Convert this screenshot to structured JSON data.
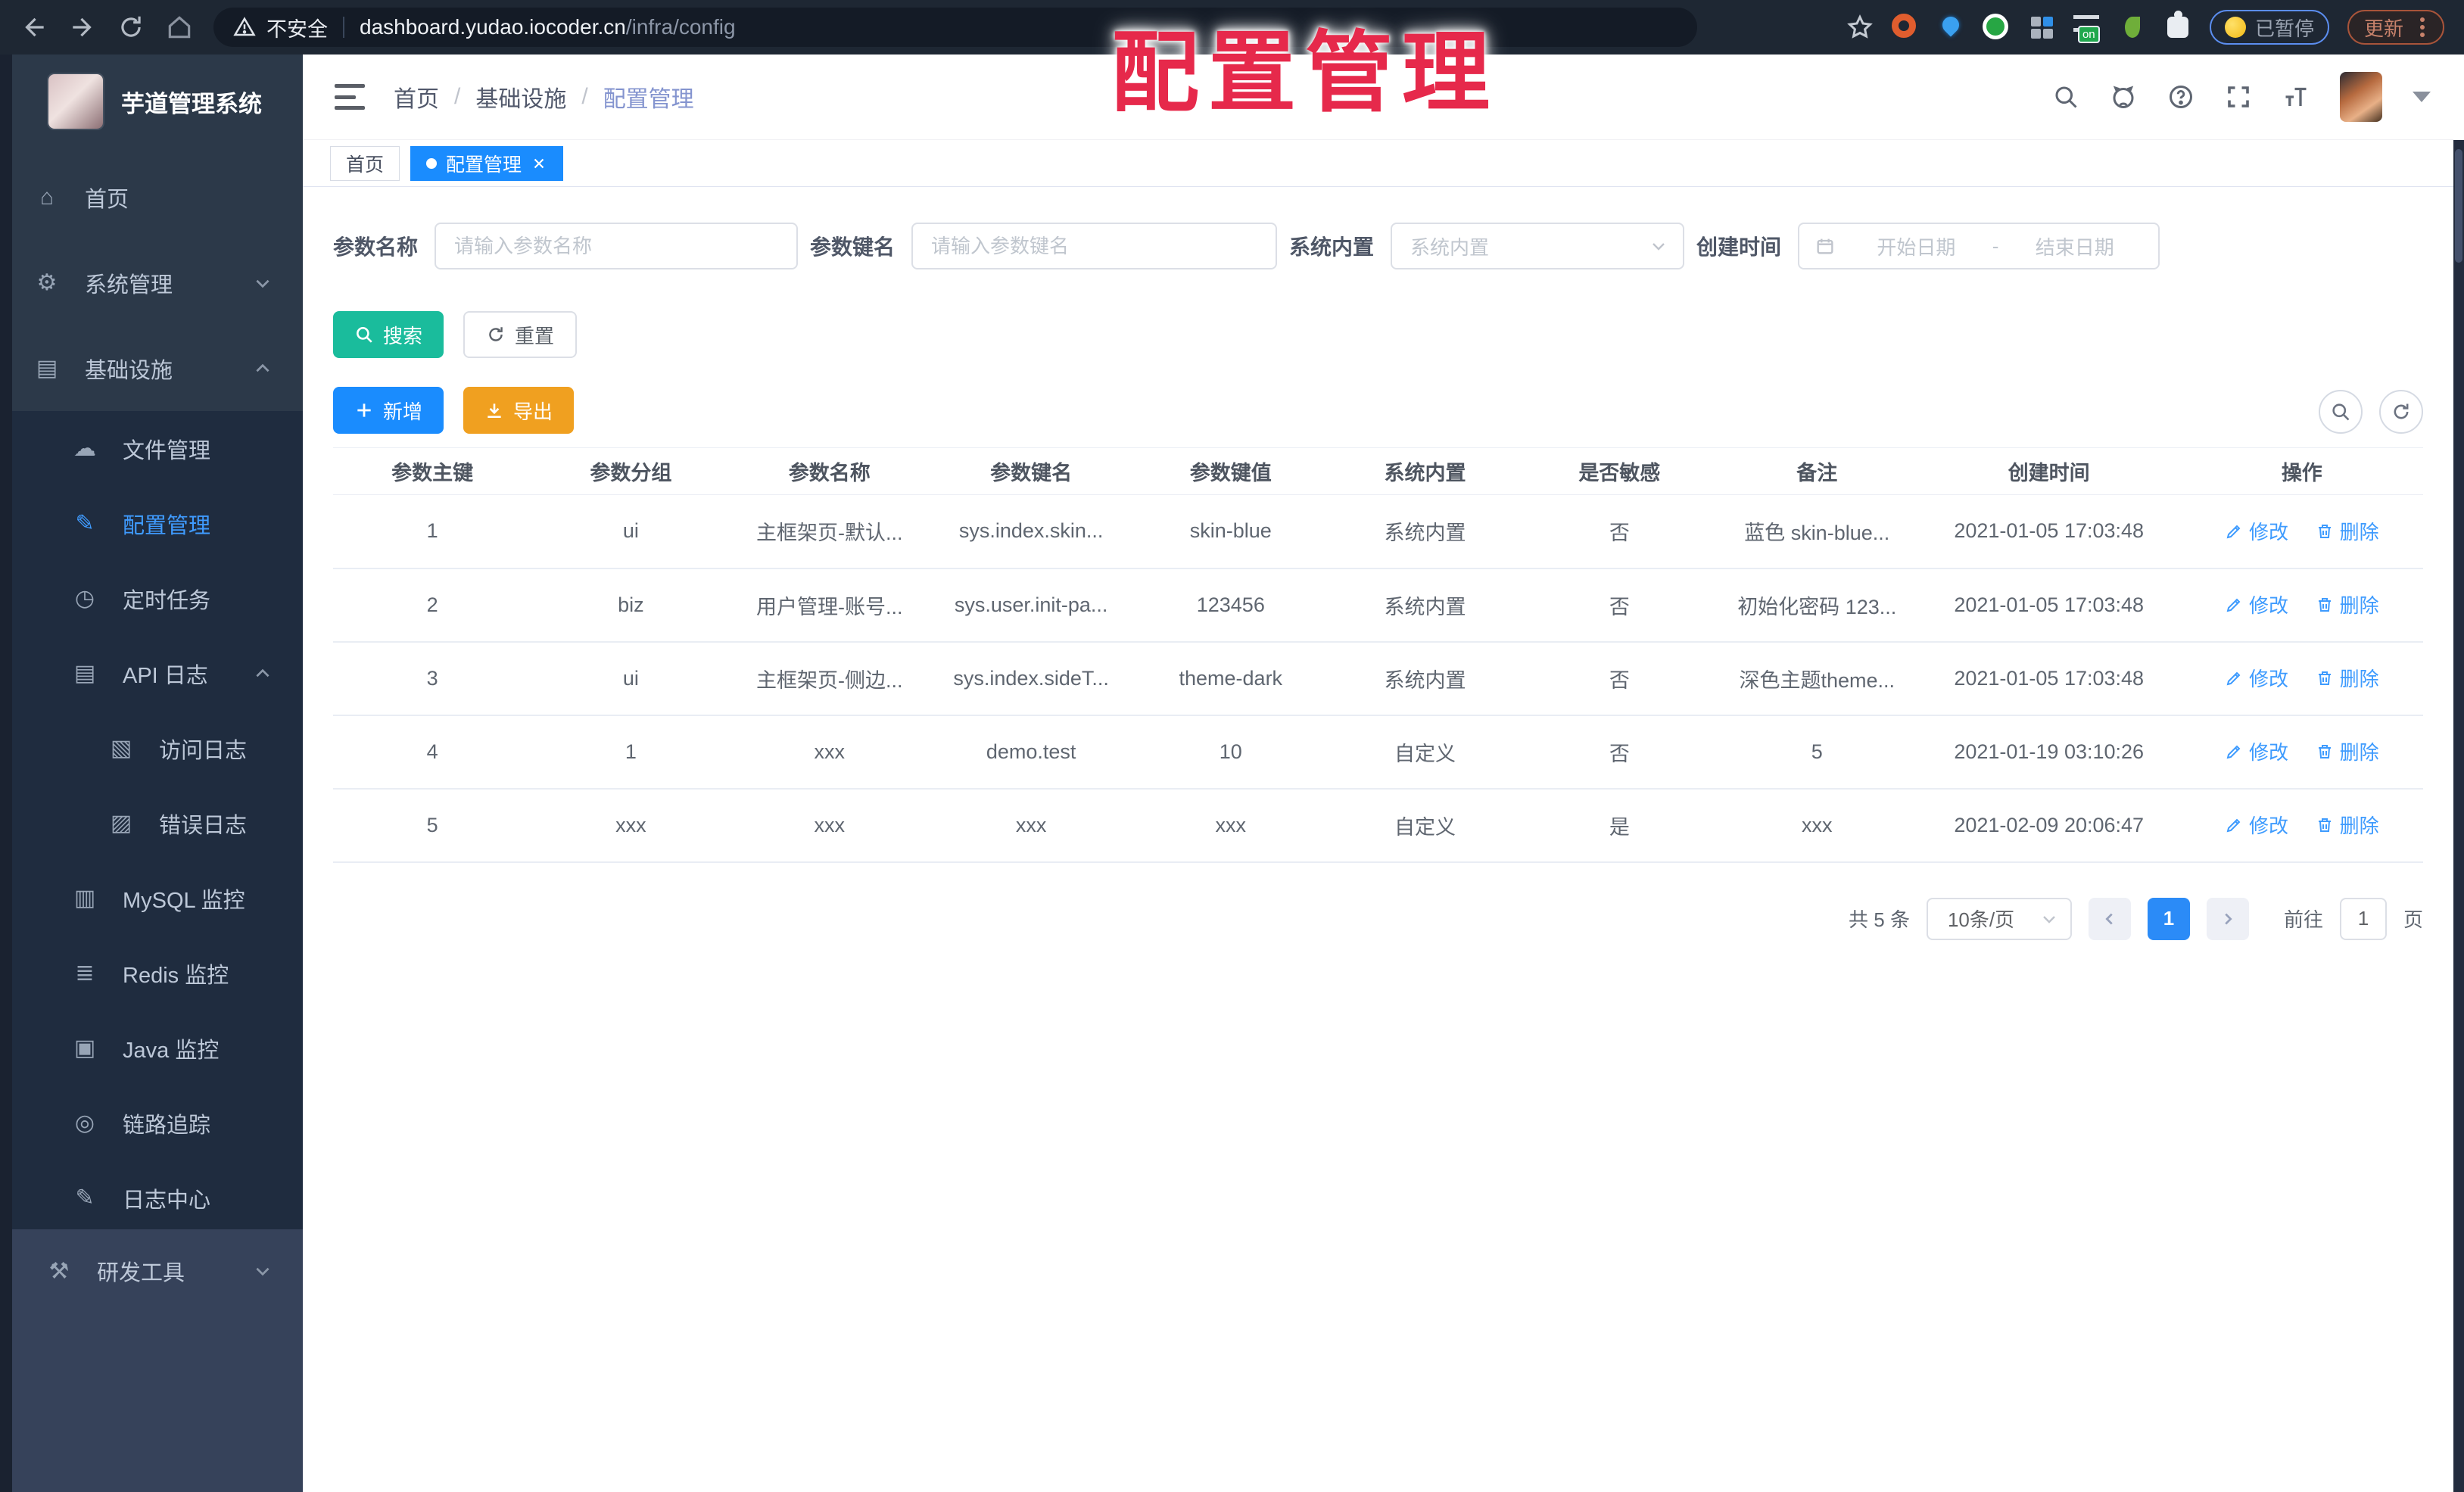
{
  "browser": {
    "security_label": "不安全",
    "url_host": "dashboard.yudao.iocoder.cn",
    "url_path": "/infra/config",
    "extension_badge": "on",
    "paused_label": "已暂停",
    "update_label": "更新"
  },
  "overlay": {
    "title": "配置管理"
  },
  "sidebar": {
    "title": "芋道管理系统",
    "items": [
      {
        "label": "首页",
        "icon": "⌂"
      },
      {
        "label": "系统管理",
        "icon": "⚙"
      },
      {
        "label": "基础设施",
        "icon": "▤"
      },
      {
        "label": "文件管理",
        "icon": "☁"
      },
      {
        "label": "配置管理",
        "icon": "✎"
      },
      {
        "label": "定时任务",
        "icon": "◷"
      },
      {
        "label": "API 日志",
        "icon": "▤"
      },
      {
        "label": "访问日志",
        "icon": "▧"
      },
      {
        "label": "错误日志",
        "icon": "▨"
      },
      {
        "label": "MySQL 监控",
        "icon": "▥"
      },
      {
        "label": "Redis 监控",
        "icon": "≣"
      },
      {
        "label": "Java 监控",
        "icon": "▣"
      },
      {
        "label": "链路追踪",
        "icon": "◎"
      },
      {
        "label": "日志中心",
        "icon": "✎"
      },
      {
        "label": "研发工具",
        "icon": "⚒"
      }
    ]
  },
  "breadcrumb": {
    "items": [
      "首页",
      "基础设施",
      "配置管理"
    ],
    "separator": "/"
  },
  "tabs": [
    {
      "label": "首页"
    },
    {
      "label": "配置管理"
    }
  ],
  "icons": {
    "close": "×"
  },
  "filters": {
    "name": {
      "label": "参数名称",
      "placeholder": "请输入参数名称"
    },
    "key": {
      "label": "参数键名",
      "placeholder": "请输入参数键名"
    },
    "builtin": {
      "label": "系统内置",
      "placeholder": "系统内置"
    },
    "created": {
      "label": "创建时间",
      "start": "开始日期",
      "separator": "-",
      "end": "结束日期"
    }
  },
  "toolbar": {
    "search": "搜索",
    "reset": "重置",
    "create": "新增",
    "export": "导出"
  },
  "table": {
    "columns": [
      "参数主键",
      "参数分组",
      "参数名称",
      "参数键名",
      "参数键值",
      "系统内置",
      "是否敏感",
      "备注",
      "创建时间",
      "操作"
    ],
    "rows": [
      [
        "1",
        "ui",
        "主框架页-默认...",
        "sys.index.skin...",
        "skin-blue",
        "系统内置",
        "否",
        "蓝色 skin-blue...",
        "2021-01-05 17:03:48"
      ],
      [
        "2",
        "biz",
        "用户管理-账号...",
        "sys.user.init-pa...",
        "123456",
        "系统内置",
        "否",
        "初始化密码 123...",
        "2021-01-05 17:03:48"
      ],
      [
        "3",
        "ui",
        "主框架页-侧边...",
        "sys.index.sideT...",
        "theme-dark",
        "系统内置",
        "否",
        "深色主题theme...",
        "2021-01-05 17:03:48"
      ],
      [
        "4",
        "1",
        "xxx",
        "demo.test",
        "10",
        "自定义",
        "否",
        "5",
        "2021-01-19 03:10:26"
      ],
      [
        "5",
        "xxx",
        "xxx",
        "xxx",
        "xxx",
        "自定义",
        "是",
        "xxx",
        "2021-02-09 20:06:47"
      ]
    ],
    "row_actions": {
      "edit": "修改",
      "delete": "删除"
    }
  },
  "pagination": {
    "total": "共 5 条",
    "page_size": "10条/页",
    "current": "1",
    "goto_label": "前往",
    "goto_value": "1",
    "page_suffix": "页"
  }
}
